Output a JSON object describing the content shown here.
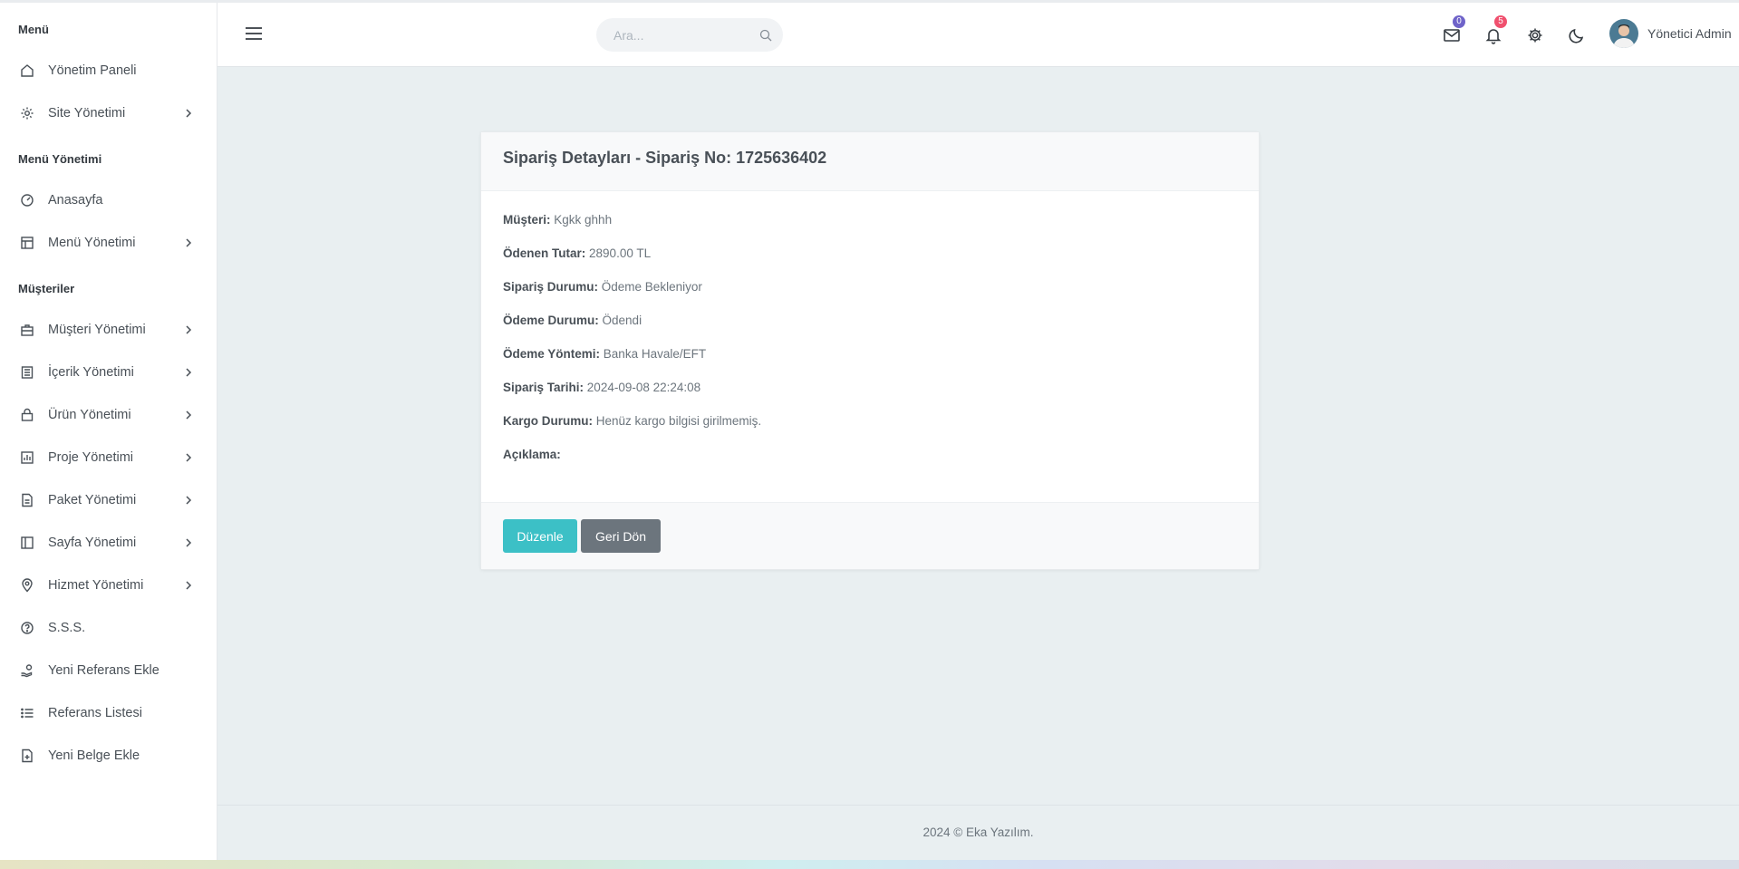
{
  "sidebar": {
    "sections": [
      {
        "title": "Menü"
      },
      {
        "title": "Menü Yönetimi"
      },
      {
        "title": "Müşteriler"
      }
    ],
    "items": [
      {
        "label": "Yönetim Paneli",
        "icon": "home-icon"
      },
      {
        "label": "Site Yönetimi",
        "icon": "gear-icon"
      },
      {
        "label": "Anasayfa",
        "icon": "dashboard-icon"
      },
      {
        "label": "Menü Yönetimi",
        "icon": "layout-icon"
      },
      {
        "label": "Müşteri Yönetimi",
        "icon": "briefcase-icon"
      },
      {
        "label": "İçerik Yönetimi",
        "icon": "list-box-icon"
      },
      {
        "label": "Ürün Yönetimi",
        "icon": "lock-bag-icon"
      },
      {
        "label": "Proje Yönetimi",
        "icon": "bar-chart-icon"
      },
      {
        "label": "Paket Yönetimi",
        "icon": "document-icon"
      },
      {
        "label": "Sayfa Yönetimi",
        "icon": "sidebar-layout-icon"
      },
      {
        "label": "Hizmet Yönetimi",
        "icon": "map-pin-icon"
      },
      {
        "label": "S.S.S.",
        "icon": "help-circle-icon"
      },
      {
        "label": "Yeni Referans Ekle",
        "icon": "hand-coin-icon"
      },
      {
        "label": "Referans Listesi",
        "icon": "list-icon"
      },
      {
        "label": "Yeni Belge Ekle",
        "icon": "file-plus-icon"
      }
    ]
  },
  "topbar": {
    "search_placeholder": "Ara...",
    "mail_badge": "0",
    "notification_badge": "5",
    "username": "Yönetici Admin"
  },
  "order": {
    "title": "Sipariş Detayları - Sipariş No: 1725636402",
    "fields": [
      {
        "label": "Müşteri:",
        "value": "Kgkk ghhh"
      },
      {
        "label": "Ödenen Tutar:",
        "value": "2890.00 TL"
      },
      {
        "label": "Sipariş Durumu:",
        "value": "Ödeme Bekleniyor"
      },
      {
        "label": "Ödeme Durumu:",
        "value": "Ödendi"
      },
      {
        "label": "Ödeme Yöntemi:",
        "value": "Banka Havale/EFT"
      },
      {
        "label": "Sipariş Tarihi:",
        "value": "2024-09-08 22:24:08"
      },
      {
        "label": "Kargo Durumu:",
        "value": "Henüz kargo bilgisi girilmemiş."
      },
      {
        "label": "Açıklama:",
        "value": ""
      }
    ],
    "edit_label": "Düzenle",
    "back_label": "Geri Dön"
  },
  "footer": {
    "text": "2024 © Eka Yazılım."
  },
  "colors": {
    "accent": "#3cc0c6",
    "secondary_button": "#6c757d",
    "mail_badge": "#6f63c9",
    "notification_badge": "#f0506e",
    "background": "#e9eff1"
  }
}
